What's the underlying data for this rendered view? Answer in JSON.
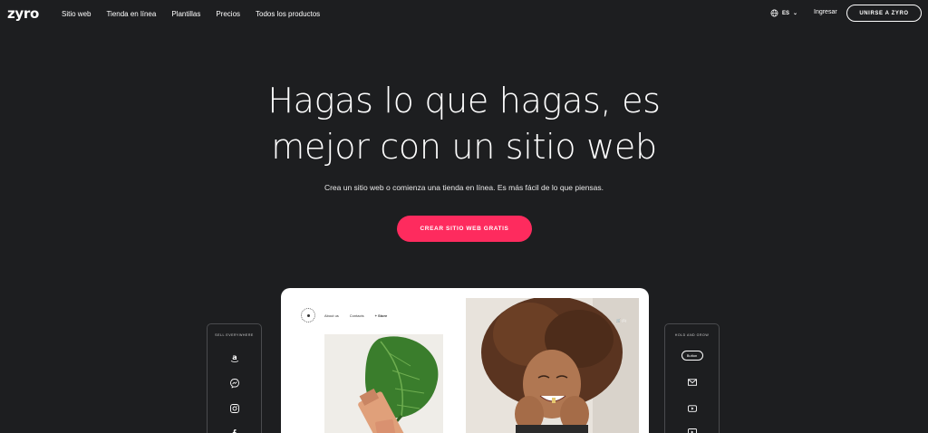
{
  "nav": {
    "logo": "zyro",
    "links": [
      "Sitio web",
      "Tienda en línea",
      "Plantillas",
      "Precios",
      "Todos los productos"
    ],
    "lang": "ES",
    "login": "Ingresar",
    "join": "UNIRSE A ZYRO"
  },
  "hero": {
    "title_line1": "Hagas lo que hagas, es",
    "title_line2": "mejor con un sitio web",
    "subtitle": "Crea un sitio web o comienza una tienda en línea. Es más fácil de lo que piensas.",
    "cta": "CREAR SITIO WEB GRATIS"
  },
  "mockup": {
    "nav": [
      "About us",
      "Contacts",
      "+ Store"
    ],
    "cart": "(1)"
  },
  "panels": {
    "left_title": "SELL EVERYWHERE",
    "left_icons": [
      "amazon-icon",
      "messenger-icon",
      "instagram-icon",
      "facebook-icon"
    ],
    "right_title": "HOLD AND GROW",
    "right_button": "Button",
    "right_icons": [
      "mail-icon",
      "youtube-icon",
      "video-icon"
    ]
  },
  "colors": {
    "background": "#1d1e20",
    "accent": "#fe2b5e",
    "text": "#ffffff"
  }
}
